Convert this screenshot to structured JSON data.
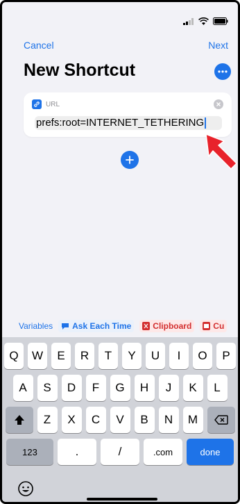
{
  "nav": {
    "cancel_label": "Cancel",
    "next_label": "Next"
  },
  "title": "New Shortcut",
  "url_card": {
    "label": "URL",
    "value": "prefs:root=INTERNET_TETHERING"
  },
  "variables_bar": {
    "label": "Variables",
    "chips": [
      "Ask Each Time",
      "Clipboard",
      "Cu"
    ]
  },
  "keyboard": {
    "row1": [
      "Q",
      "W",
      "E",
      "R",
      "T",
      "Y",
      "U",
      "I",
      "O",
      "P"
    ],
    "row2": [
      "A",
      "S",
      "D",
      "F",
      "G",
      "H",
      "J",
      "K",
      "L"
    ],
    "row3": [
      "Z",
      "X",
      "C",
      "V",
      "B",
      "N",
      "M"
    ],
    "bottom": {
      "numbers": "123",
      "dot": ".",
      "slash": "/",
      "dotcom": ".com",
      "done": "done"
    }
  },
  "colors": {
    "accent": "#1e73e8",
    "annotation_arrow": "#e8222b"
  }
}
